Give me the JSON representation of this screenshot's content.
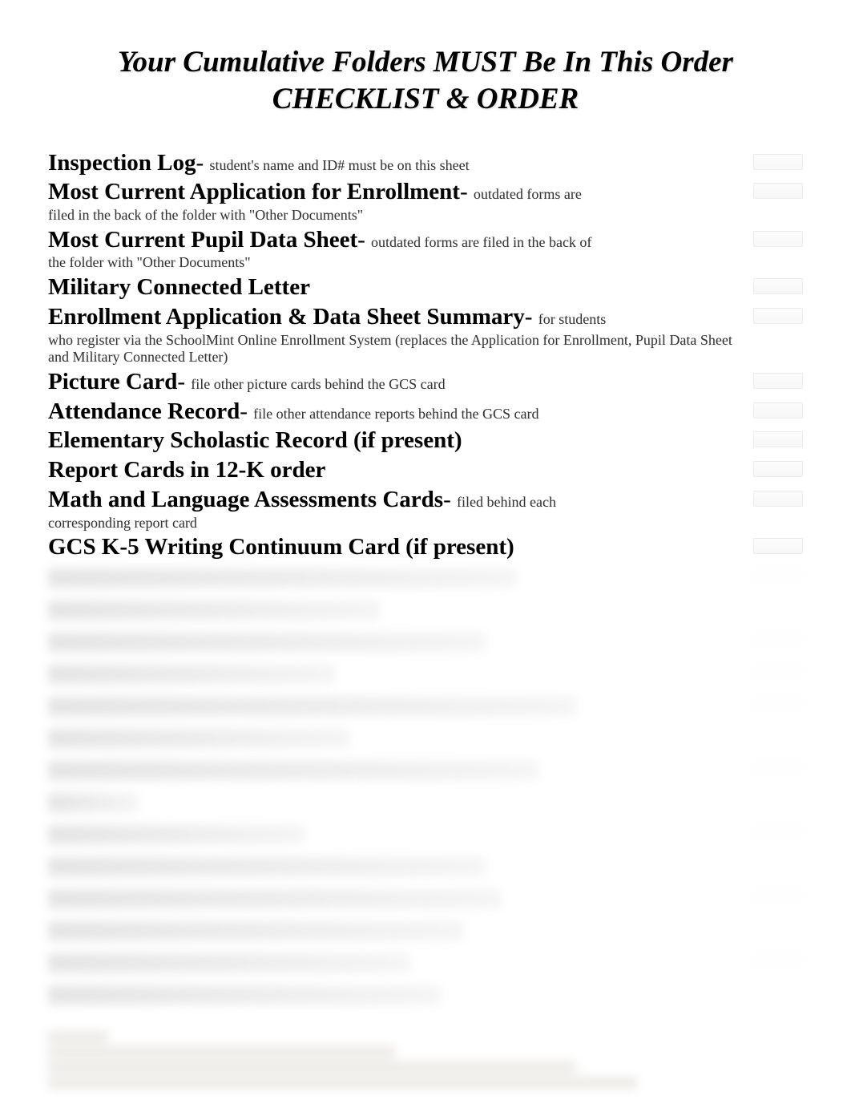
{
  "title": {
    "line1": "Your Cumulative Folders MUST Be In This Order",
    "line2": "CHECKLIST & ORDER"
  },
  "items": [
    {
      "title": "Inspection Log",
      "dash": "- ",
      "note": "student's name and ID# must be on this sheet",
      "noteCont": ""
    },
    {
      "title": "Most Current Application for Enrollment",
      "dash": "- ",
      "note": "outdated forms are",
      "noteCont": "filed in the back of the folder with \"Other Documents\""
    },
    {
      "title": "Most Current Pupil Data Sheet",
      "dash": "- ",
      "note": "outdated forms are filed in the back of",
      "noteCont": "the folder with \"Other Documents\""
    },
    {
      "title": "Military Connected Letter",
      "dash": "",
      "note": "",
      "noteCont": ""
    },
    {
      "title": "Enrollment Application & Data Sheet Summary",
      "dash": "- ",
      "note": "for students",
      "noteCont": "who register via the SchoolMint Online Enrollment System (replaces the Application for Enrollment, Pupil Data Sheet and Military Connected Letter)"
    },
    {
      "title": "Picture Card",
      "dash": "- ",
      "note": "file other picture cards behind the GCS card",
      "noteCont": ""
    },
    {
      "title": "Attendance Record",
      "dash": "- ",
      "note": "file other attendance reports behind the GCS card",
      "noteCont": ""
    },
    {
      "title": "Elementary Scholastic Record (if present)",
      "dash": "",
      "note": "",
      "noteCont": ""
    },
    {
      "title": "Report Cards in 12-K order",
      "dash": "",
      "note": "",
      "noteCont": ""
    },
    {
      "title": "Math and Language Assessments Cards",
      "dash": "- ",
      "note": "filed behind each",
      "noteCont": "corresponding report card"
    },
    {
      "title": "GCS K-5 Writing Continuum Card (if present)",
      "dash": "",
      "note": "",
      "noteCont": ""
    }
  ],
  "blurredWidths": [
    "62%",
    "44%",
    "58%",
    "38%",
    "70%",
    "40%",
    "65%",
    "12%",
    "34%",
    "58%",
    "60%",
    "55%",
    "48%",
    "52%"
  ],
  "noteWidths": [
    "8%",
    "46%",
    "70%",
    "78%"
  ]
}
